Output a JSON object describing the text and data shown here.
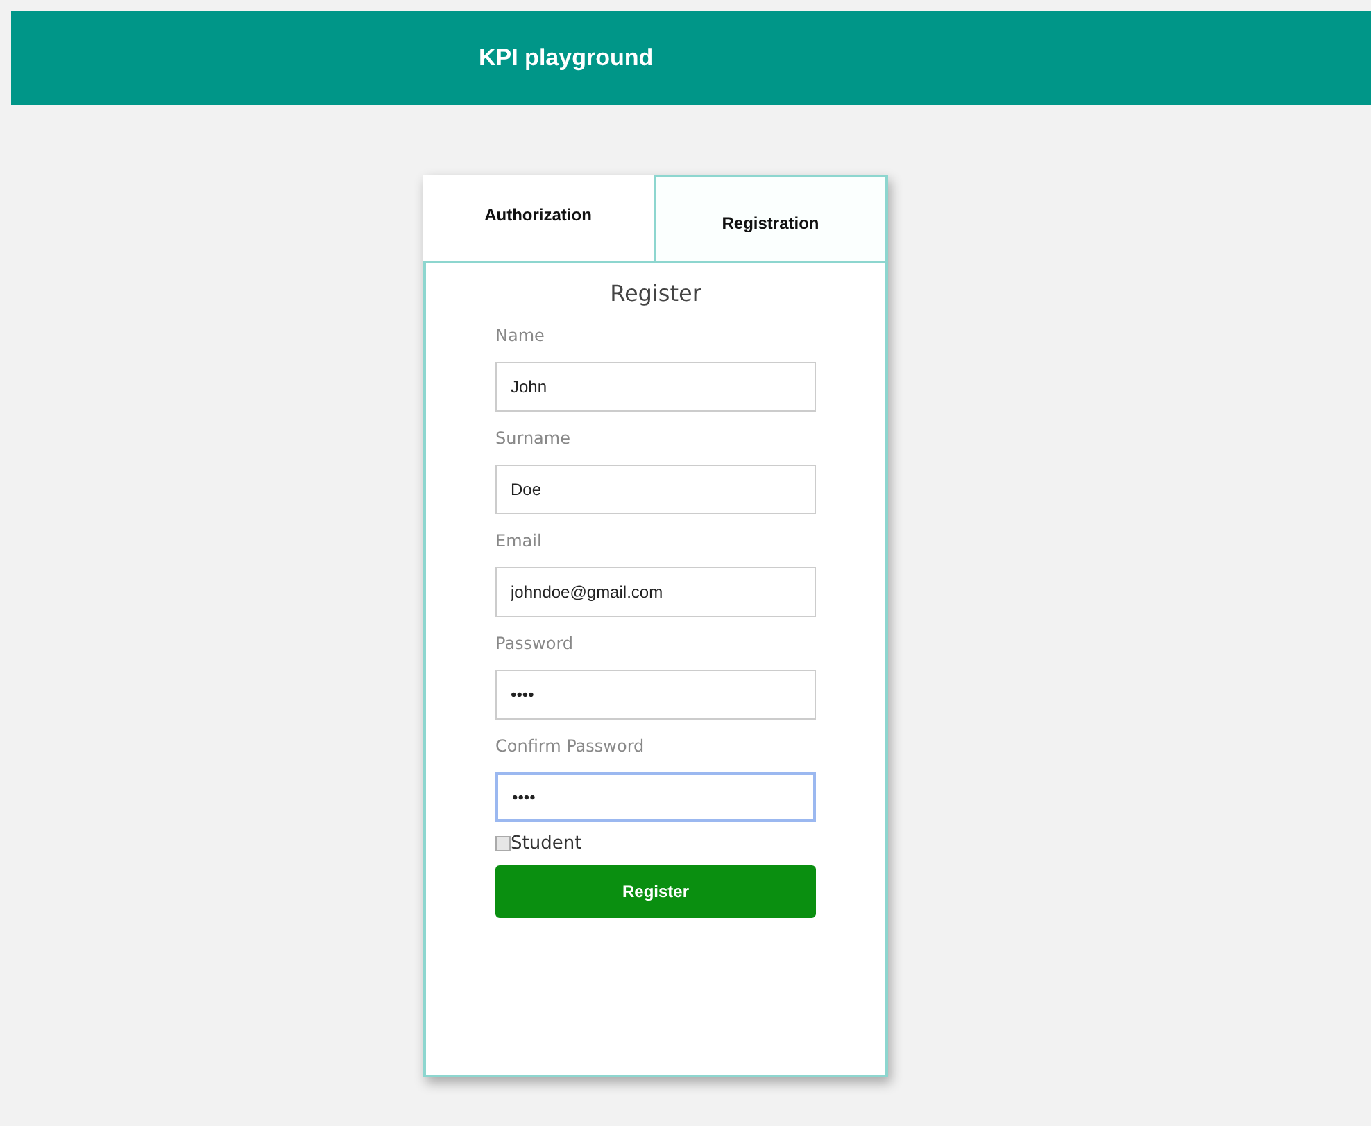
{
  "header": {
    "title": "KPI playground"
  },
  "tabs": [
    {
      "label": "Authorization",
      "selected": false
    },
    {
      "label": "Registration",
      "selected": true
    }
  ],
  "form": {
    "title": "Register",
    "fields": [
      {
        "label": "Name",
        "value": "John",
        "focused": false
      },
      {
        "label": "Surname",
        "value": "Doe",
        "focused": false
      },
      {
        "label": "Email",
        "value": "johndoe@gmail.com",
        "focused": false
      },
      {
        "label": "Password",
        "value": "••••",
        "focused": false
      },
      {
        "label": "Confirm Password",
        "value": "••••",
        "focused": true
      }
    ],
    "checkbox": {
      "label": "Student",
      "checked": false
    },
    "submit": "Register"
  }
}
